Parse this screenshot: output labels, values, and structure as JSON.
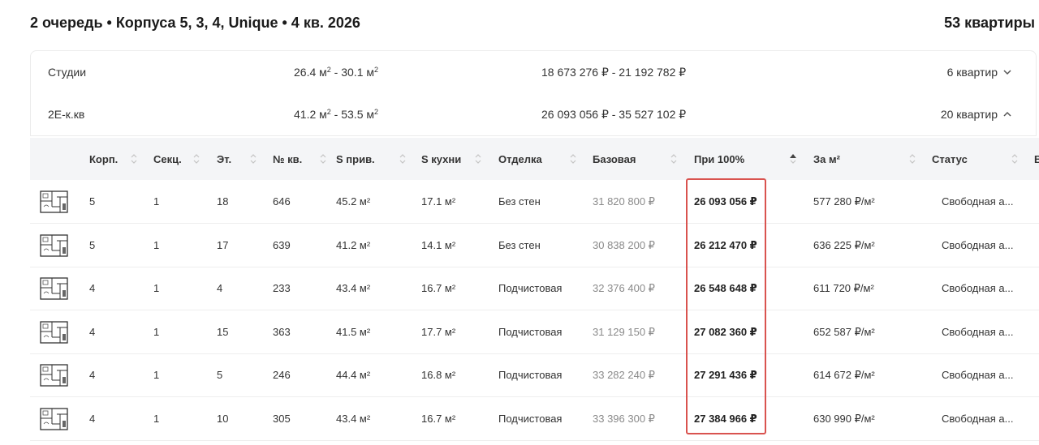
{
  "header": {
    "title": "2 очередь • Корпуса 5, 3, 4, Unique • 4 кв. 2026",
    "total": "53 квартиры"
  },
  "groups": [
    {
      "type": "Студии",
      "area_from": "26.4 м",
      "area_to": "30.1 м",
      "price_range": "18 673 276 ₽ - 21 192 782 ₽",
      "count": "6 квартир",
      "expanded": false
    },
    {
      "type": "2Е-к.кв",
      "area_from": "41.2 м",
      "area_to": "53.5 м",
      "price_range": "26 093 056 ₽ - 35 527 102 ₽",
      "count": "20 квартир",
      "expanded": true
    }
  ],
  "area_sup": "2",
  "columns": [
    "Корп.",
    "Секц.",
    "Эт.",
    "№ кв.",
    "S прив.",
    "S кухни",
    "Отделка",
    "Базовая",
    "При 100%",
    "За м²",
    "Статус",
    "В"
  ],
  "rows": [
    {
      "korp": "5",
      "sekc": "1",
      "floor": "18",
      "num": "646",
      "s_priv": "45.2 м²",
      "s_kitchen": "17.1 м²",
      "finish": "Без стен",
      "base": "31 820 800 ₽",
      "price100": "26 093 056 ₽",
      "per_m2": "577 280 ₽/м²",
      "status": "Свободная а..."
    },
    {
      "korp": "5",
      "sekc": "1",
      "floor": "17",
      "num": "639",
      "s_priv": "41.2 м²",
      "s_kitchen": "14.1 м²",
      "finish": "Без стен",
      "base": "30 838 200 ₽",
      "price100": "26 212 470 ₽",
      "per_m2": "636 225 ₽/м²",
      "status": "Свободная а..."
    },
    {
      "korp": "4",
      "sekc": "1",
      "floor": "4",
      "num": "233",
      "s_priv": "43.4 м²",
      "s_kitchen": "16.7 м²",
      "finish": "Подчистовая",
      "base": "32 376 400 ₽",
      "price100": "26 548 648 ₽",
      "per_m2": "611 720 ₽/м²",
      "status": "Свободная а..."
    },
    {
      "korp": "4",
      "sekc": "1",
      "floor": "15",
      "num": "363",
      "s_priv": "41.5 м²",
      "s_kitchen": "17.7 м²",
      "finish": "Подчистовая",
      "base": "31 129 150 ₽",
      "price100": "27 082 360 ₽",
      "per_m2": "652 587 ₽/м²",
      "status": "Свободная а..."
    },
    {
      "korp": "4",
      "sekc": "1",
      "floor": "5",
      "num": "246",
      "s_priv": "44.4 м²",
      "s_kitchen": "16.8 м²",
      "finish": "Подчистовая",
      "base": "33 282 240 ₽",
      "price100": "27 291 436 ₽",
      "per_m2": "614 672 ₽/м²",
      "status": "Свободная а..."
    },
    {
      "korp": "4",
      "sekc": "1",
      "floor": "10",
      "num": "305",
      "s_priv": "43.4 м²",
      "s_kitchen": "16.7 м²",
      "finish": "Подчистовая",
      "base": "33 396 300 ₽",
      "price100": "27 384 966 ₽",
      "per_m2": "630 990 ₽/м²",
      "status": "Свободная а..."
    }
  ],
  "colors": {
    "highlight": "#d9534f",
    "header_bg": "#f4f5f7",
    "muted": "#8a8a8a"
  }
}
